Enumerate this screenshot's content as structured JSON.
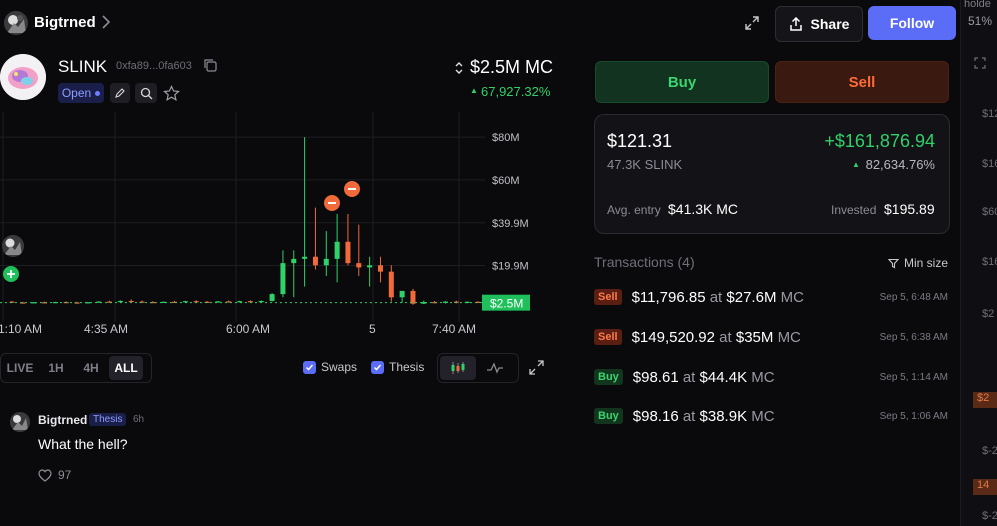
{
  "header": {
    "username": "Bigtrned",
    "share_label": "Share",
    "follow_label": "Follow"
  },
  "token": {
    "symbol": "SLINK",
    "address": "0xfa89...0fa603",
    "status": "Open",
    "market_cap": "$2.5M MC",
    "change": "67,927.32%"
  },
  "chart": {
    "y_ticks": [
      "$80M",
      "$60M",
      "$39.9M",
      "$19.9M"
    ],
    "current_label": "$2.5M",
    "x_ticks": [
      "1:10 AM",
      "4:35 AM",
      "6:00 AM",
      "5",
      "7:40 AM"
    ],
    "timeframes": [
      "LIVE",
      "1H",
      "4H",
      "ALL"
    ],
    "active_timeframe": "ALL",
    "swaps_label": "Swaps",
    "thesis_label": "Thesis"
  },
  "chart_data": {
    "type": "candlestick",
    "unit": "$M",
    "ylim": [
      0,
      88
    ],
    "candles": [
      {
        "o": 3.0,
        "h": 3.2,
        "l": 2.4,
        "c": 2.6
      },
      {
        "o": 2.6,
        "h": 2.9,
        "l": 2.3,
        "c": 2.5
      },
      {
        "o": 2.5,
        "h": 2.8,
        "l": 2.2,
        "c": 2.7
      },
      {
        "o": 2.7,
        "h": 3.0,
        "l": 2.4,
        "c": 2.5
      },
      {
        "o": 2.5,
        "h": 2.9,
        "l": 2.3,
        "c": 2.8
      },
      {
        "o": 2.8,
        "h": 3.1,
        "l": 2.5,
        "c": 2.6
      },
      {
        "o": 2.6,
        "h": 2.9,
        "l": 2.3,
        "c": 2.5
      },
      {
        "o": 2.5,
        "h": 2.8,
        "l": 2.3,
        "c": 2.7
      },
      {
        "o": 2.7,
        "h": 3.2,
        "l": 2.5,
        "c": 3.0
      },
      {
        "o": 3.0,
        "h": 3.4,
        "l": 2.6,
        "c": 2.8
      },
      {
        "o": 2.8,
        "h": 3.6,
        "l": 2.6,
        "c": 3.3
      },
      {
        "o": 3.3,
        "h": 4.0,
        "l": 2.8,
        "c": 3.0
      },
      {
        "o": 3.0,
        "h": 3.5,
        "l": 2.6,
        "c": 2.8
      },
      {
        "o": 2.8,
        "h": 3.2,
        "l": 2.5,
        "c": 2.7
      },
      {
        "o": 2.7,
        "h": 3.0,
        "l": 2.4,
        "c": 2.9
      },
      {
        "o": 2.9,
        "h": 3.3,
        "l": 2.6,
        "c": 2.8
      },
      {
        "o": 2.8,
        "h": 3.4,
        "l": 2.5,
        "c": 3.2
      },
      {
        "o": 3.2,
        "h": 3.6,
        "l": 2.6,
        "c": 2.9
      },
      {
        "o": 2.9,
        "h": 3.3,
        "l": 2.6,
        "c": 2.8
      },
      {
        "o": 2.8,
        "h": 3.3,
        "l": 2.5,
        "c": 3.1
      },
      {
        "o": 3.1,
        "h": 3.5,
        "l": 2.7,
        "c": 2.9
      },
      {
        "o": 2.9,
        "h": 3.4,
        "l": 2.6,
        "c": 3.2
      },
      {
        "o": 3.2,
        "h": 3.6,
        "l": 2.8,
        "c": 3.0
      },
      {
        "o": 3.0,
        "h": 3.5,
        "l": 2.7,
        "c": 3.3
      },
      {
        "o": 3.3,
        "h": 7.0,
        "l": 3.0,
        "c": 6.5
      },
      {
        "o": 6.5,
        "h": 27.0,
        "l": 5.0,
        "c": 21.0
      },
      {
        "o": 21.0,
        "h": 27.0,
        "l": 5.0,
        "c": 23.0
      },
      {
        "o": 23.0,
        "h": 80.0,
        "l": 10.0,
        "c": 24.0
      },
      {
        "o": 24.0,
        "h": 47.0,
        "l": 18.0,
        "c": 20.0
      },
      {
        "o": 20.0,
        "h": 36.0,
        "l": 15.0,
        "c": 23.0
      },
      {
        "o": 23.0,
        "h": 44.0,
        "l": 12.0,
        "c": 31.0
      },
      {
        "o": 31.0,
        "h": 44.0,
        "l": 20.0,
        "c": 21.0
      },
      {
        "o": 21.0,
        "h": 39.0,
        "l": 15.0,
        "c": 19.0
      },
      {
        "o": 19.0,
        "h": 24.0,
        "l": 10.0,
        "c": 20.0
      },
      {
        "o": 20.0,
        "h": 24.0,
        "l": 12.0,
        "c": 17.0
      },
      {
        "o": 17.0,
        "h": 20.0,
        "l": 3.0,
        "c": 5.0
      },
      {
        "o": 5.0,
        "h": 8.0,
        "l": 2.5,
        "c": 8.0
      },
      {
        "o": 8.0,
        "h": 9.0,
        "l": 1.5,
        "c": 2.0
      },
      {
        "o": 2.0,
        "h": 3.5,
        "l": 1.8,
        "c": 2.8
      },
      {
        "o": 2.8,
        "h": 3.3,
        "l": 2.2,
        "c": 2.4
      },
      {
        "o": 2.4,
        "h": 3.2,
        "l": 2.1,
        "c": 3.0
      },
      {
        "o": 3.0,
        "h": 3.4,
        "l": 2.2,
        "c": 2.5
      },
      {
        "o": 2.5,
        "h": 3.1,
        "l": 2.2,
        "c": 2.9
      },
      {
        "o": 2.9,
        "h": 3.1,
        "l": 2.3,
        "c": 2.5
      }
    ],
    "current": 2.5
  },
  "comment": {
    "author": "Bigtrned",
    "tag": "Thesis",
    "age": "6h",
    "text": "What the hell?",
    "likes": "97"
  },
  "trade": {
    "buy_label": "Buy",
    "sell_label": "Sell"
  },
  "position": {
    "value": "$121.31",
    "amount": "47.3K SLINK",
    "pnl": "+$161,876.94",
    "pnl_pct": "82,634.76%",
    "avg_entry_label": "Avg. entry",
    "avg_entry": "$41.3K MC",
    "invested_label": "Invested",
    "invested": "$195.89"
  },
  "transactions": {
    "title": "Transactions (4)",
    "filter_label": "Min size",
    "rows": [
      {
        "side": "Sell",
        "amount": "$11,796.85",
        "at": "at",
        "mc": "$27.6M",
        "unit": "MC",
        "time": "Sep 5, 6:48 AM"
      },
      {
        "side": "Sell",
        "amount": "$149,520.92",
        "at": "at",
        "mc": "$35M",
        "unit": "MC",
        "time": "Sep 5, 6:38 AM"
      },
      {
        "side": "Buy",
        "amount": "$98.61",
        "at": "at",
        "mc": "$44.4K",
        "unit": "MC",
        "time": "Sep 5, 1:14 AM"
      },
      {
        "side": "Buy",
        "amount": "$98.16",
        "at": "at",
        "mc": "$38.9K",
        "unit": "MC",
        "time": "Sep 5, 1:06 AM"
      }
    ]
  },
  "edge": {
    "top_fragment": "holde",
    "pct_fragment": "51%",
    "values": [
      "$12",
      "$16",
      "$60",
      "$16",
      "$2",
      "$-2",
      "$-2"
    ],
    "badges": [
      "$2",
      "14"
    ]
  },
  "colors": {
    "green": "#2fd169",
    "red": "#f06a3a",
    "accent": "#5b6cf7"
  }
}
